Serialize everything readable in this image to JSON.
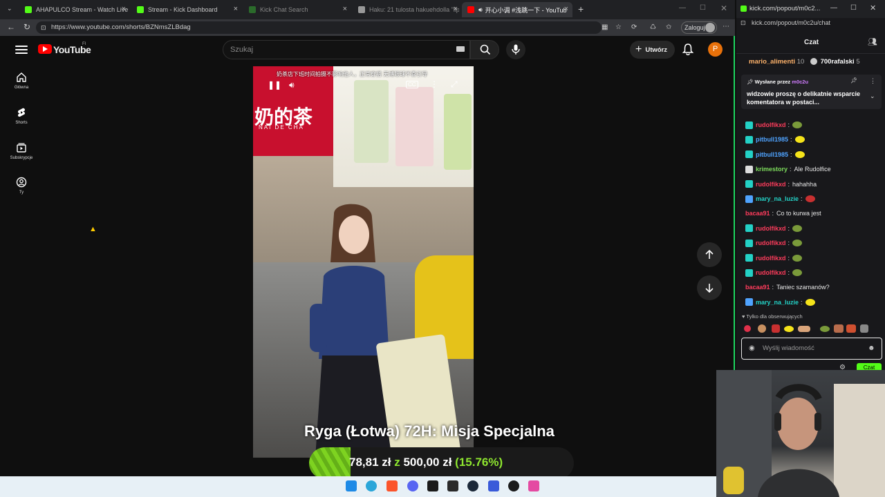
{
  "browser": {
    "tabs": [
      {
        "title": "AHAPULCO Stream - Watch Live o",
        "fav_color": "#53fc18"
      },
      {
        "title": "Stream - Kick Dashboard",
        "fav_color": "#53fc18"
      },
      {
        "title": "Kick Chat Search",
        "fav_color": "#2b6b2b"
      },
      {
        "title": "Haku: 21 tulosta hakuehdolla \"lip",
        "fav_color": "#999999"
      },
      {
        "title": "开心小调 #浅跳一下 - YouTub",
        "fav_color": "#ff0000"
      }
    ],
    "url": "https://www.youtube.com/shorts/BZNmsZLBdag",
    "profile_label": "Zaloguj"
  },
  "youtube": {
    "wordmark": "YouTube",
    "region": "FI",
    "search_placeholder": "Szukaj",
    "create_label": "Utwórz",
    "avatar_letter": "P",
    "sidebar": [
      {
        "label": "Główna",
        "icon": "home-icon"
      },
      {
        "label": "Shorts",
        "icon": "shorts-icon"
      },
      {
        "label": "Subskrypcje",
        "icon": "subscriptions-icon"
      },
      {
        "label": "Ty",
        "icon": "user-icon"
      }
    ],
    "video": {
      "caption": "奶茶店下班时间拍摄不影响他人，正常穿搭 无博眼球不喜引导",
      "shop_sign_cn": "奶的茶",
      "shop_sign_en": "NAI DE CHA"
    }
  },
  "overlay": {
    "title": "Ryga (Łotwa) 72H: Misja Specjalna",
    "raised": "78,81 zł",
    "joiner": "z",
    "goal": "500,00 zł",
    "percent_label": "(15.76%)",
    "progress": 0.1576
  },
  "kick": {
    "url": "kick.com/popout/m0c2u/chat",
    "window_title": "kick.com/popout/m0c2...",
    "header": "Czat",
    "top_users": [
      {
        "name": "mario_alimenti",
        "count": "10"
      },
      {
        "name": "700rafalski",
        "count": "5"
      }
    ],
    "pinned": {
      "by_label": "Wysłane przez",
      "by_user": "m0c2u",
      "text": "widzowie proszę o delikatnie wsparcie komentatora w postaci..."
    },
    "messages": [
      {
        "user": "rudolfikxd",
        "text": "",
        "color": "#ff3c5c",
        "badge": "#23d1c6",
        "emote": "#7a9a3a"
      },
      {
        "user": "pitbull1985",
        "text": "",
        "color": "#4fa3ff",
        "badge": "#23d1c6",
        "emote": "#f5e31a"
      },
      {
        "user": "pitbull1985",
        "text": "",
        "color": "#4fa3ff",
        "badge": "#23d1c6",
        "emote": "#f5e31a"
      },
      {
        "user": "krimestory",
        "text": "Ale Rudolfice",
        "color": "#7ddc5c",
        "badge": "#dddddd",
        "emote": ""
      },
      {
        "user": "rudolfikxd",
        "text": "hahahha",
        "color": "#ff3c5c",
        "badge": "#23d1c6",
        "emote": ""
      },
      {
        "user": "mary_na_luzie",
        "text": "",
        "color": "#23d1c6",
        "badge": "#4fa3ff",
        "emote": "#c83030"
      },
      {
        "user": "bacaa91",
        "text": "Co to kurwa jest",
        "color": "#ff3c5c",
        "badge": "",
        "emote": ""
      },
      {
        "user": "rudolfikxd",
        "text": "",
        "color": "#ff3c5c",
        "badge": "#23d1c6",
        "emote": "#7a9a3a"
      },
      {
        "user": "rudolfikxd",
        "text": "",
        "color": "#ff3c5c",
        "badge": "#23d1c6",
        "emote": "#7a9a3a"
      },
      {
        "user": "rudolfikxd",
        "text": "",
        "color": "#ff3c5c",
        "badge": "#23d1c6",
        "emote": "#7a9a3a"
      },
      {
        "user": "rudolfikxd",
        "text": "",
        "color": "#ff3c5c",
        "badge": "#23d1c6",
        "emote": "#7a9a3a"
      },
      {
        "user": "bacaa91",
        "text": "Taniec szamanów?",
        "color": "#ff3c5c",
        "badge": "",
        "emote": ""
      },
      {
        "user": "mary_na_luzie",
        "text": "",
        "color": "#23d1c6",
        "badge": "#4fa3ff",
        "emote": "#f5e31a"
      }
    ],
    "followers_only": "Tylko dla obserwujących",
    "input_placeholder": "Wyślij wiadomość",
    "send_label": "Czat"
  },
  "colors": {
    "kick_green": "#53fc18",
    "youtube_red": "#ff0000",
    "progress_green": "#7ed320"
  }
}
